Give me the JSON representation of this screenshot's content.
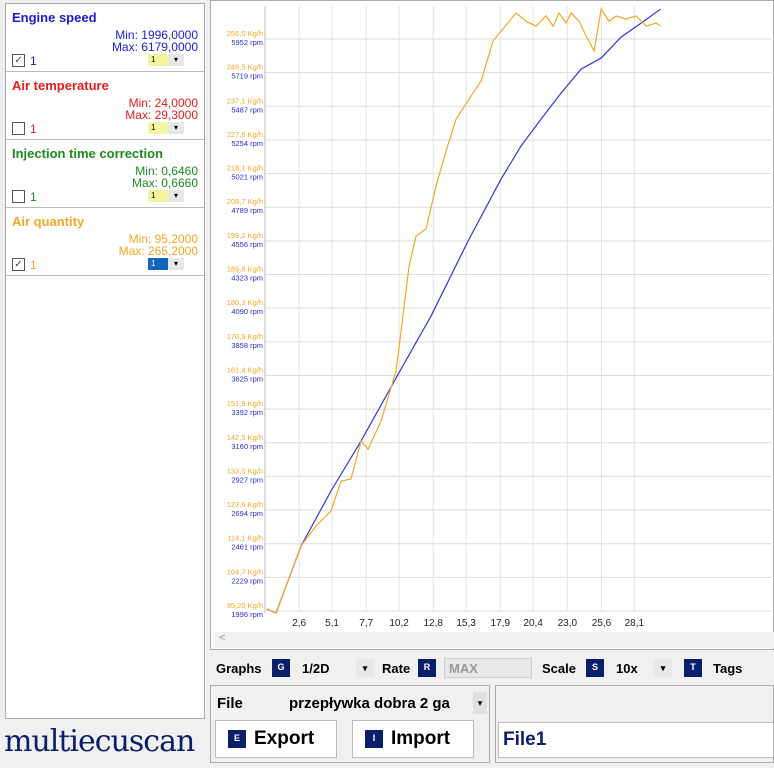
{
  "channels": [
    {
      "name": "Engine speed",
      "min": "Min: 1996,0000",
      "max": "Max: 6179,0000",
      "checked": true,
      "num": "1",
      "sel": "1",
      "color": "#1b1bd6"
    },
    {
      "name": "Air temperature",
      "min": "Min: 24,0000",
      "max": "Max: 29,3000",
      "checked": false,
      "num": "1",
      "sel": "1",
      "color": "#e81c1c"
    },
    {
      "name": "Injection time correction",
      "min": "Min: 0,6460",
      "max": "Max: 0,6660",
      "checked": false,
      "num": "1",
      "sel": "1",
      "color": "#1e8a1e"
    },
    {
      "name": "Air quantity",
      "min": "Min: 95,2000",
      "max": "Max: 265,2000",
      "checked": true,
      "num": "1",
      "sel": "1",
      "color": "#f5a623"
    }
  ],
  "toolbar": {
    "graphs": "Graphs",
    "graphs_key": "G",
    "graphs_val": "1/2D",
    "rate": "Rate",
    "rate_key": "R",
    "rate_val": "MAX",
    "scale": "Scale",
    "scale_key": "S",
    "scale_val": "10x",
    "tags_key": "T",
    "tags": "Tags"
  },
  "file": {
    "label": "File",
    "value": "przepływka dobra 2 ga",
    "export_key": "E",
    "export": "Export",
    "import_key": "I",
    "import": "Import",
    "name": "File1"
  },
  "logo": "multiecuscan",
  "scroll_left": "<",
  "chart_data": {
    "type": "line",
    "x_ticks": [
      "2,6",
      "5,1",
      "7,7",
      "10,2",
      "12,8",
      "15,3",
      "17,9",
      "20,4",
      "23,0",
      "25,6",
      "28,1"
    ],
    "x_tick_values": [
      2.6,
      5.1,
      7.7,
      10.2,
      12.8,
      15.3,
      17.9,
      20.4,
      23.0,
      25.6,
      28.1
    ],
    "xlim": [
      0,
      38.8
    ],
    "y_ticks_kgh": [
      "95,20 Kg/h",
      "104,7 Kg/h",
      "114,1 Kg/h",
      "123,6 Kg/h",
      "133,0 Kg/h",
      "142,5 Kg/h",
      "151,9 Kg/h",
      "161,4 Kg/h",
      "170,9 Kg/h",
      "180,3 Kg/h",
      "189,8 Kg/h",
      "199,2 Kg/h",
      "208,7 Kg/h",
      "218,1 Kg/h",
      "227,6 Kg/h",
      "237,1 Kg/h",
      "246,5 Kg/h",
      "256,0 Kg/h"
    ],
    "y_ticks_rpm": [
      "1996 rpm",
      "2229 rpm",
      "2461 rpm",
      "2694 rpm",
      "2927 rpm",
      "3160 rpm",
      "3392 rpm",
      "3625 rpm",
      "3858 rpm",
      "4090 rpm",
      "4323 rpm",
      "4556 rpm",
      "4789 rpm",
      "5021 rpm",
      "5254 rpm",
      "5487 rpm",
      "5719 rpm",
      "5952 rpm"
    ],
    "ylim_kgh": [
      95.2,
      256.0
    ],
    "ylim_rpm": [
      1996,
      5952
    ],
    "series": [
      {
        "name": "Engine speed",
        "unit": "rpm",
        "color": "#3535e0",
        "x": [
          0.15,
          0.84,
          2.74,
          5.02,
          7.31,
          10.35,
          12.63,
          15.45,
          17.96,
          19.48,
          21.0,
          22.52,
          24.05,
          25.57,
          27.09,
          28.61,
          30.1
        ],
        "y": [
          2010,
          1982,
          2445,
          2826,
          3172,
          3669,
          4036,
          4555,
          4983,
          5212,
          5398,
          5578,
          5744,
          5820,
          5965,
          6062,
          6159
        ]
      },
      {
        "name": "Air quantity",
        "unit": "Kg/h",
        "color": "#f5a623",
        "x": [
          0.15,
          0.84,
          2.74,
          3.88,
          5.02,
          5.78,
          6.54,
          7.31,
          7.84,
          8.83,
          9.97,
          10.35,
          10.96,
          11.49,
          12.25,
          13.01,
          13.77,
          14.54,
          15.68,
          16.44,
          17.35,
          17.96,
          19.1,
          19.86,
          20.62,
          21.38,
          21.92,
          22.37,
          22.91,
          23.29,
          23.9,
          24.43,
          25.04,
          25.57,
          26.18,
          26.71,
          27.47,
          28.24,
          29.0,
          29.75,
          30.1
        ],
        "y": [
          95.8,
          94.6,
          113.5,
          119.1,
          123.3,
          131.7,
          132.3,
          143.0,
          140.7,
          148.6,
          162.7,
          173.9,
          192.2,
          200.6,
          202.6,
          214.7,
          224.5,
          233.5,
          240.0,
          244.2,
          255.4,
          258.2,
          263.3,
          261.0,
          259.6,
          262.5,
          259.6,
          263.3,
          260.5,
          263.3,
          261.0,
          256.8,
          252.6,
          264.4,
          261.0,
          262.5,
          261.6,
          262.5,
          259.6,
          260.5,
          259.6
        ]
      }
    ]
  }
}
